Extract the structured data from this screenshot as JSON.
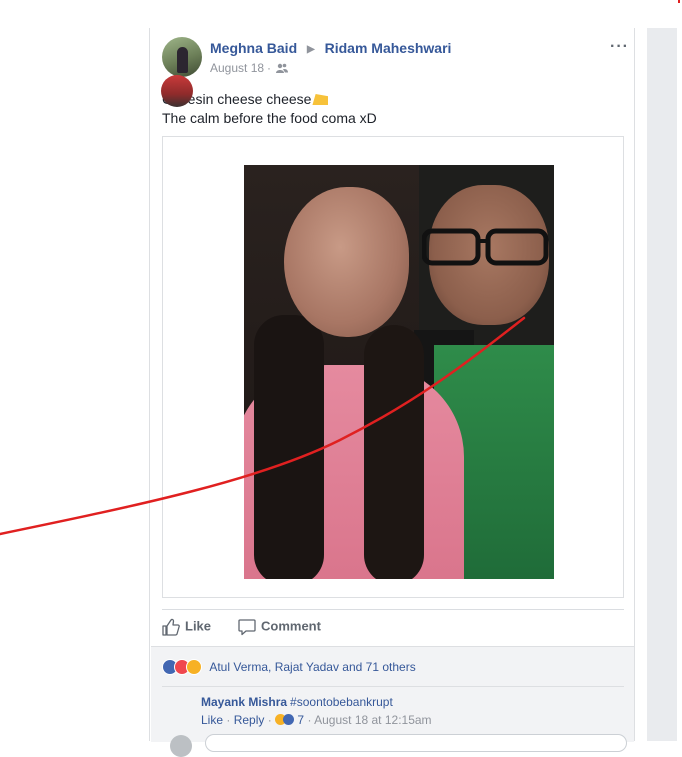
{
  "post": {
    "author": "Meghna Baid",
    "target": "Ridam Maheshwari",
    "date": "August 18",
    "meta_sep": "·",
    "more": "···",
    "text_line1": "Cheesin cheese cheese",
    "text_line2": "The calm before the food coma xD"
  },
  "actions": {
    "like_label": "Like",
    "comment_label": "Comment"
  },
  "reactions": {
    "summary": "Atul Verma, Rajat Yadav and 71 others"
  },
  "comments": [
    {
      "author": "Mayank Mishra",
      "text": "#soontobebankrupt",
      "like_label": "Like",
      "reply_label": "Reply",
      "sep": "·",
      "reaction_count": "7",
      "timestamp": "August 18 at 12:15am"
    }
  ],
  "colors": {
    "link": "#365899",
    "muted": "#90949c",
    "annotation_line": "#e02020"
  }
}
